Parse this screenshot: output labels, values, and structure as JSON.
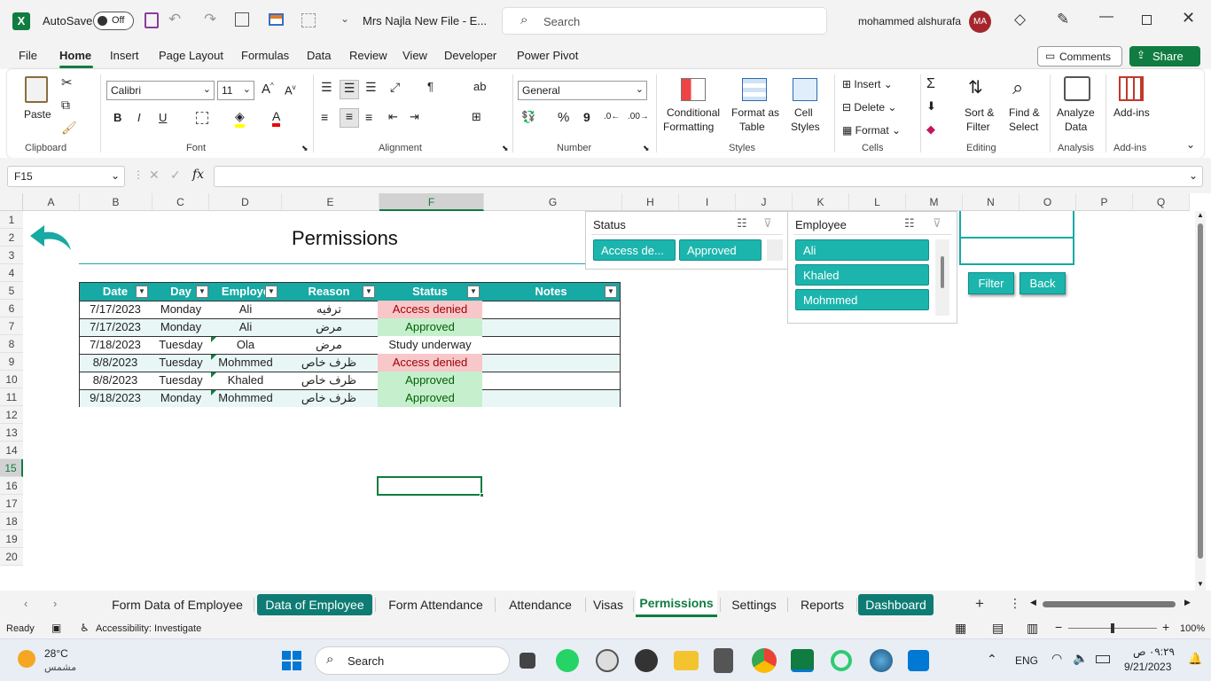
{
  "app": {
    "autosave_label": "AutoSave",
    "autosave_state": "Off",
    "file_title": "Mrs Najla New File  -  E...",
    "search_placeholder": "Search",
    "user_name": "mohammed alshurafa",
    "user_initials": "MA"
  },
  "menu": [
    "File",
    "Home",
    "Insert",
    "Page Layout",
    "Formulas",
    "Data",
    "Review",
    "View",
    "Developer",
    "Power Pivot"
  ],
  "menu_right": {
    "comments": "Comments",
    "share": "Share"
  },
  "ribbon": {
    "clipboard": {
      "paste": "Paste",
      "label": "Clipboard"
    },
    "font": {
      "name": "Calibri",
      "size": "11",
      "label": "Font",
      "bold": "B",
      "italic": "I",
      "underline": "U"
    },
    "alignment": {
      "label": "Alignment"
    },
    "number": {
      "format": "General",
      "label": "Number",
      "percent": "%",
      "comma": "9"
    },
    "styles": {
      "conditional": "Conditional",
      "conditional2": "Formatting",
      "format_as": "Format as",
      "format_as2": "Table",
      "cell": "Cell",
      "cell2": "Styles",
      "label": "Styles"
    },
    "cells": {
      "insert": "Insert",
      "delete": "Delete",
      "format": "Format",
      "label": "Cells"
    },
    "editing": {
      "sort": "Sort &",
      "sort2": "Filter",
      "find": "Find &",
      "find2": "Select",
      "label": "Editing"
    },
    "analysis": {
      "analyze": "Analyze",
      "analyze2": "Data",
      "label": "Analysis"
    },
    "addins": {
      "addins": "Add-ins",
      "label": "Add-ins"
    }
  },
  "formula_bar": {
    "name_box": "F15",
    "fx": "fx",
    "formula": ""
  },
  "columns": [
    "A",
    "B",
    "C",
    "D",
    "E",
    "F",
    "G",
    "H",
    "I",
    "J",
    "K",
    "L",
    "M",
    "N",
    "O",
    "P",
    "Q"
  ],
  "rows": [
    "1",
    "2",
    "3",
    "4",
    "5",
    "6",
    "7",
    "8",
    "9",
    "10",
    "11",
    "12",
    "13",
    "14",
    "15",
    "16",
    "17",
    "18",
    "19",
    "20"
  ],
  "sheet": {
    "title": "Permissions",
    "table_headers": [
      "Date",
      "Day",
      "Employe",
      "Reason",
      "Status",
      "Notes"
    ],
    "table_rows": [
      {
        "date": "7/17/2023",
        "day": "Monday",
        "employee": "Ali",
        "reason": "ترفيه",
        "status": "Access denied",
        "notes": ""
      },
      {
        "date": "7/17/2023",
        "day": "Monday",
        "employee": "Ali",
        "reason": "مرض",
        "status": "Approved",
        "notes": ""
      },
      {
        "date": "7/18/2023",
        "day": "Tuesday",
        "employee": "Ola",
        "reason": "مرض",
        "status": "Study underway",
        "notes": ""
      },
      {
        "date": "8/8/2023",
        "day": "Tuesday",
        "employee": "Mohmmed",
        "reason": "ظرف خاص",
        "status": "Access denied",
        "notes": ""
      },
      {
        "date": "8/8/2023",
        "day": "Tuesday",
        "employee": "Khaled",
        "reason": "ظرف خاص",
        "status": "Approved",
        "notes": ""
      },
      {
        "date": "9/18/2023",
        "day": "Monday",
        "employee": "Mohmmed",
        "reason": "ظرف خاص",
        "status": "Approved",
        "notes": ""
      }
    ],
    "status_colors": {
      "Access denied": "#f8c7c9",
      "Approved": "#c6efce",
      "Study underway": "#ffffff"
    },
    "status_text_colors": {
      "Access denied": "#9c0006",
      "Approved": "#006100",
      "Study underway": "#222222"
    }
  },
  "slicers": {
    "status": {
      "title": "Status",
      "items": [
        "Access de...",
        "Approved"
      ]
    },
    "employee": {
      "title": "Employee",
      "items": [
        "Ali",
        "Khaled",
        "Mohmmed"
      ]
    }
  },
  "buttons": {
    "filter": "Filter",
    "back": "Back"
  },
  "sheet_tabs": [
    "Form Data of Employee",
    "Data of Employee",
    "Form Attendance",
    "Attendance",
    "Visas",
    "Permissions",
    "Settings",
    "Reports",
    "Dashboard"
  ],
  "active_tab": "Permissions",
  "status_bar": {
    "ready": "Ready",
    "accessibility": "Accessibility: Investigate",
    "zoom": "100%"
  },
  "taskbar": {
    "weather_temp": "28°C",
    "weather_desc": "مشمس",
    "search": "Search",
    "lang": "ENG",
    "time": "٠٩:٢٩ ص",
    "date": "9/21/2023"
  },
  "colors": {
    "accent": "#107c41",
    "teal": "#17a9a4",
    "slicer": "#1cb5ad"
  }
}
